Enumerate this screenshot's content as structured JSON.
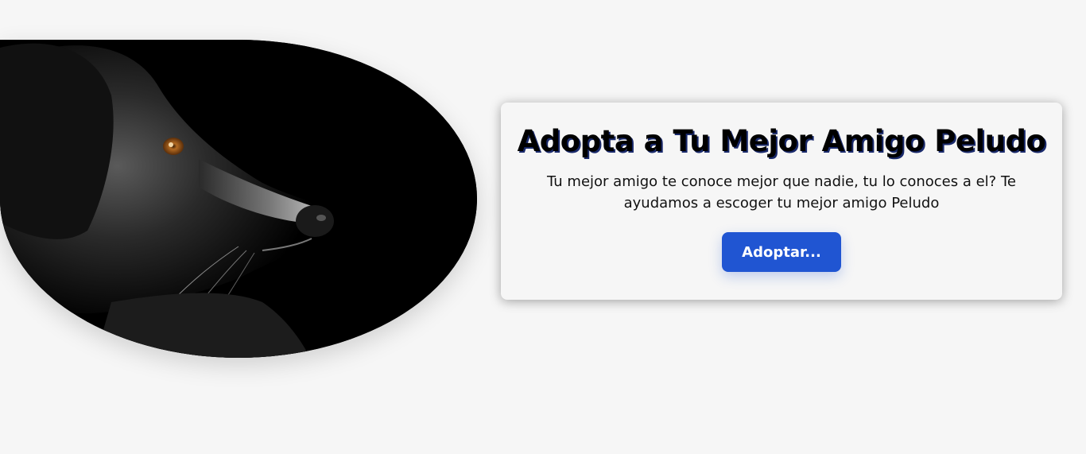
{
  "hero": {
    "alt": "dog-portrait"
  },
  "card": {
    "title": "Adopta a Tu Mejor Amigo Peludo",
    "description": "Tu mejor amigo te conoce mejor que nadie, tu lo conoces a el? Te ayudamos a escoger tu mejor amigo Peludo",
    "button_label": "Adoptar..."
  },
  "colors": {
    "background": "#f6f6f6",
    "button": "#2055d2",
    "title_shadow": "#1a2a6c"
  }
}
